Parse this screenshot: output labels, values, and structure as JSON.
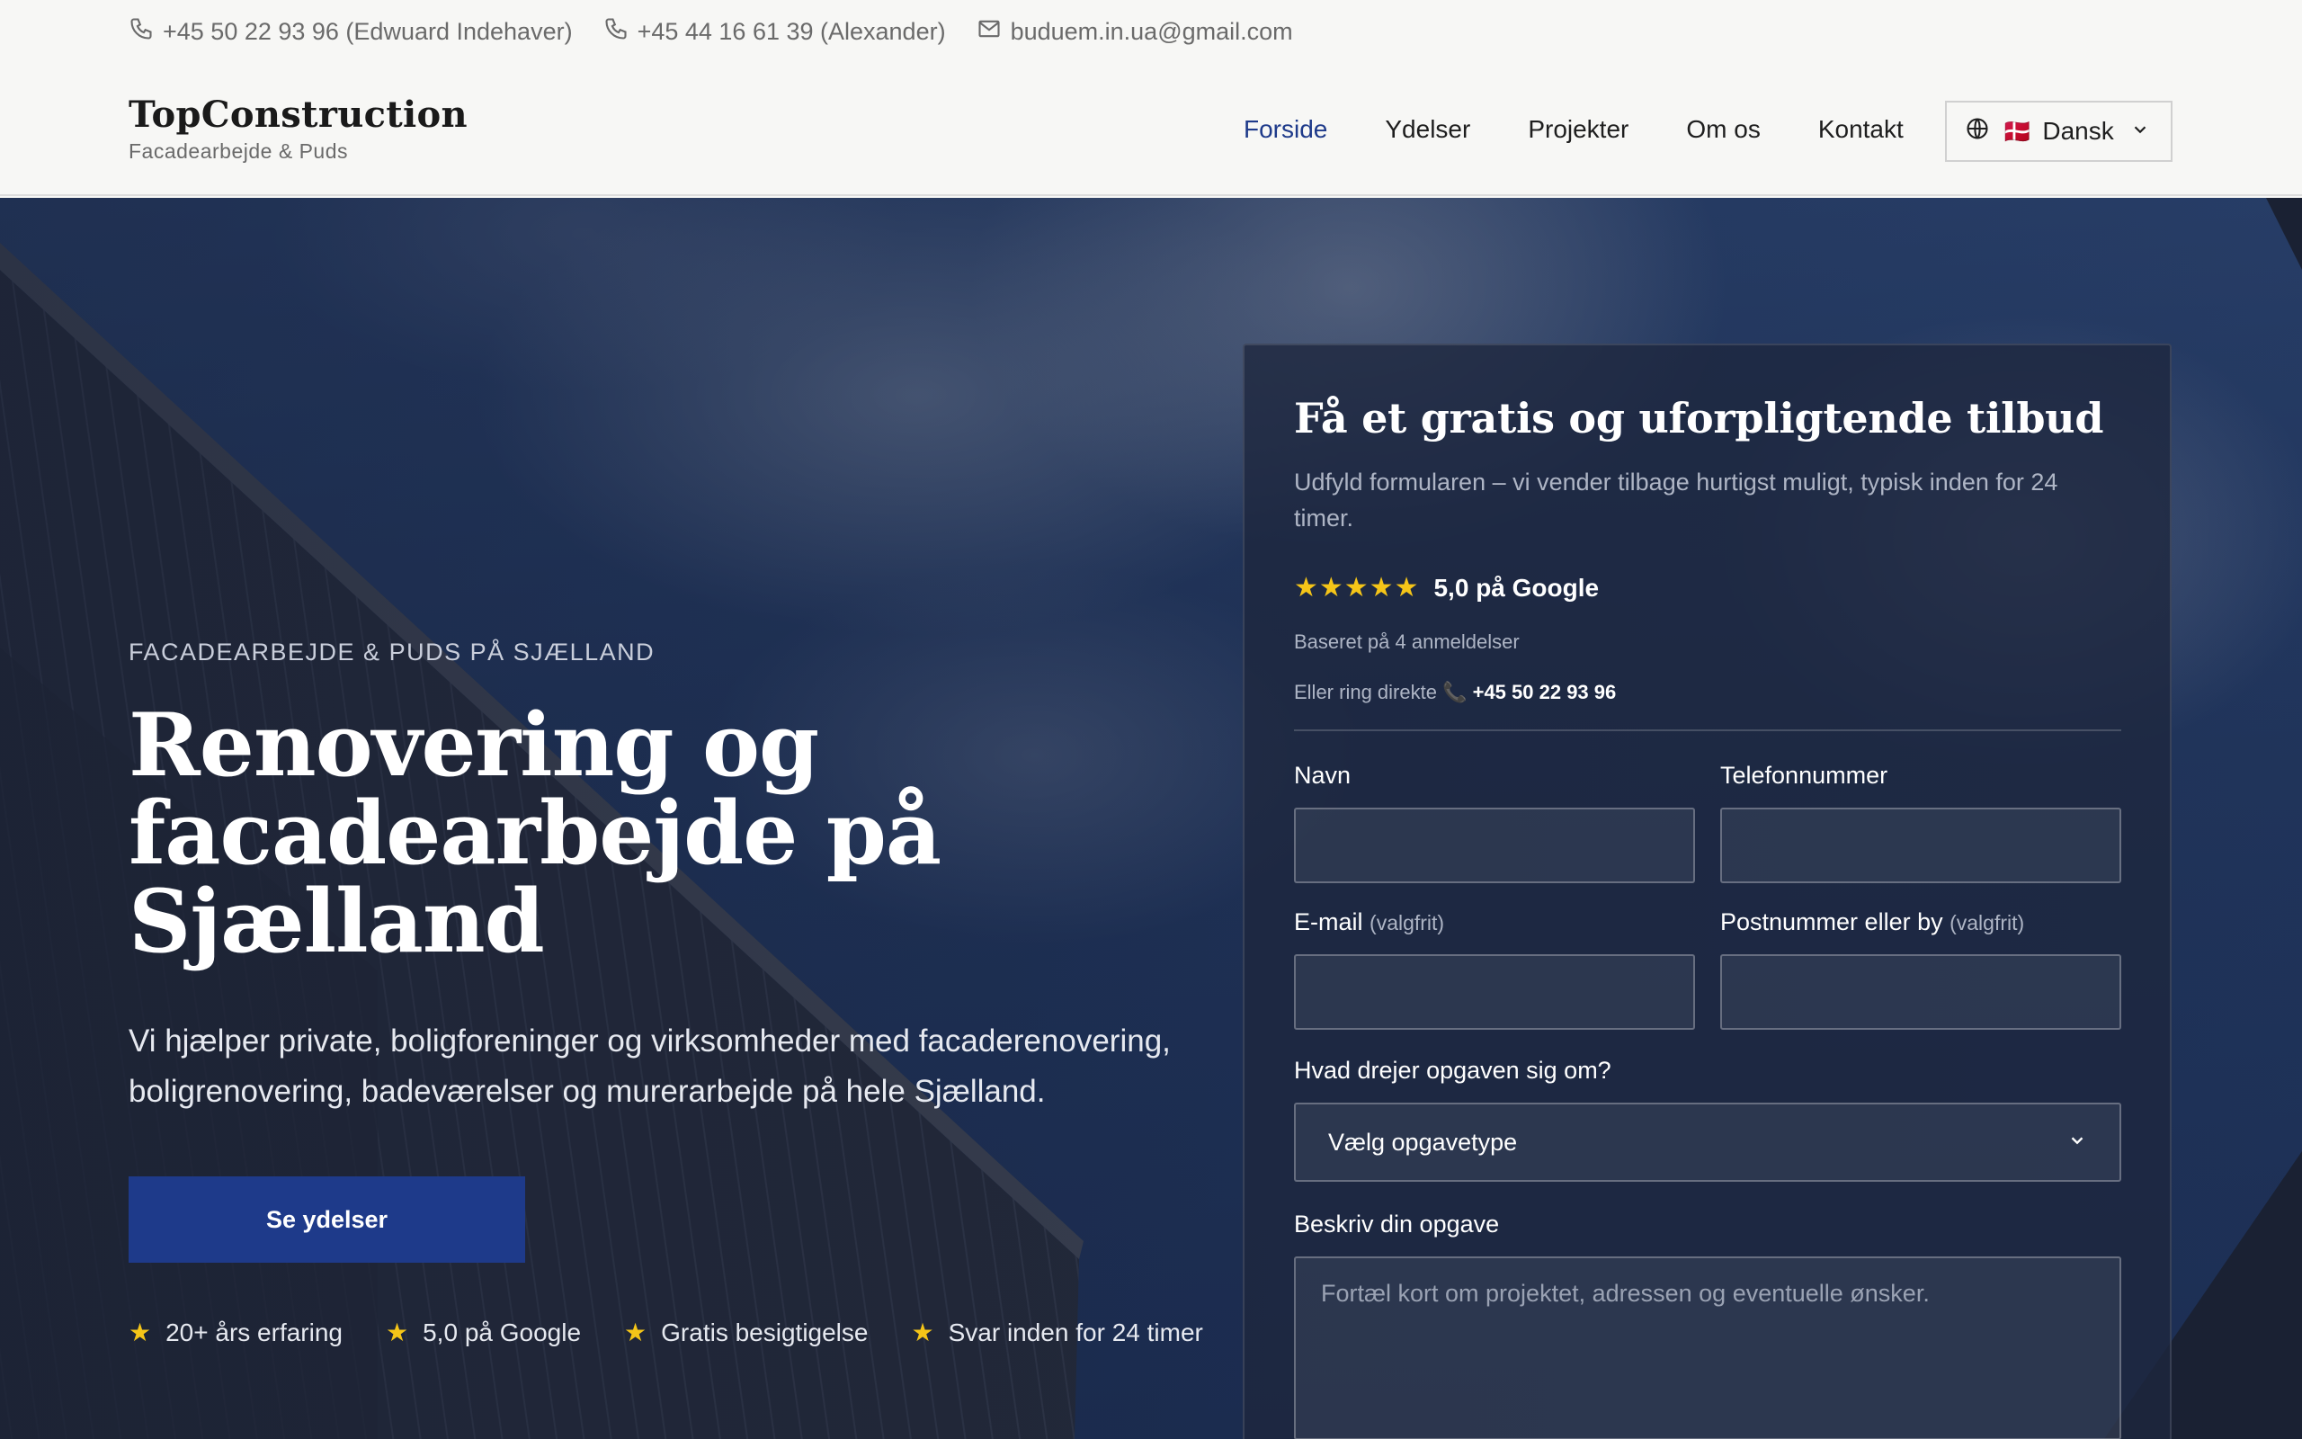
{
  "topbar": {
    "phone1": "+45 50 22 93 96 (Edwuard Indehaver)",
    "phone2": "+45 44 16 61 39 (Alexander)",
    "email": "buduem.in.ua@gmail.com"
  },
  "brand": {
    "name": "TopConstruction",
    "tagline": "Facadearbejde & Puds"
  },
  "nav": {
    "items": [
      "Forside",
      "Ydelser",
      "Projekter",
      "Om os",
      "Kontakt"
    ],
    "active": "Forside"
  },
  "language": {
    "flag": "🇩🇰",
    "label": "Dansk"
  },
  "hero": {
    "eyebrow": "FACADEARBEJDE & PUDS PÅ SJÆLLAND",
    "title": "Renovering og facadearbejde på Sjælland",
    "text": "Vi hjælper private, boligforeninger og virksomheder med facaderenovering, boligrenovering, badeværelser og murerarbejde på hele Sjælland.",
    "cta": "Se ydelser",
    "badges": [
      "20+ års erfaring",
      "5,0 på Google",
      "Gratis besigtigelse",
      "Svar inden for 24 timer"
    ]
  },
  "form": {
    "title": "Få et gratis og uforpligtende tilbud",
    "subtitle": "Udfyld formularen – vi vender tilbage hurtigst muligt, typisk inden for 24 timer.",
    "stars": "★★★★★",
    "rating": "5,0 på Google",
    "based_on": "Baseret på 4 anmeldelser",
    "call_prefix": "Eller ring direkte 📞",
    "call_number": "+45 50 22 93 96",
    "name_label": "Navn",
    "phone_label": "Telefonnummer",
    "email_label": "E-mail",
    "optional": "(valgfrit)",
    "postal_label": "Postnummer eller by",
    "task_label": "Hvad drejer opgaven sig om?",
    "task_select": "Vælg opgavetype",
    "desc_label": "Beskriv din opgave",
    "desc_placeholder": "Fortæl kort om projektet, adressen og eventuelle ønsker."
  },
  "colors": {
    "accent": "#1e3a8a",
    "star": "#f5c518",
    "hero_dark": "#1f3560"
  },
  "icons": [
    "phone-icon",
    "mail-icon",
    "globe-icon",
    "chevron-down-icon",
    "star-icon"
  ]
}
